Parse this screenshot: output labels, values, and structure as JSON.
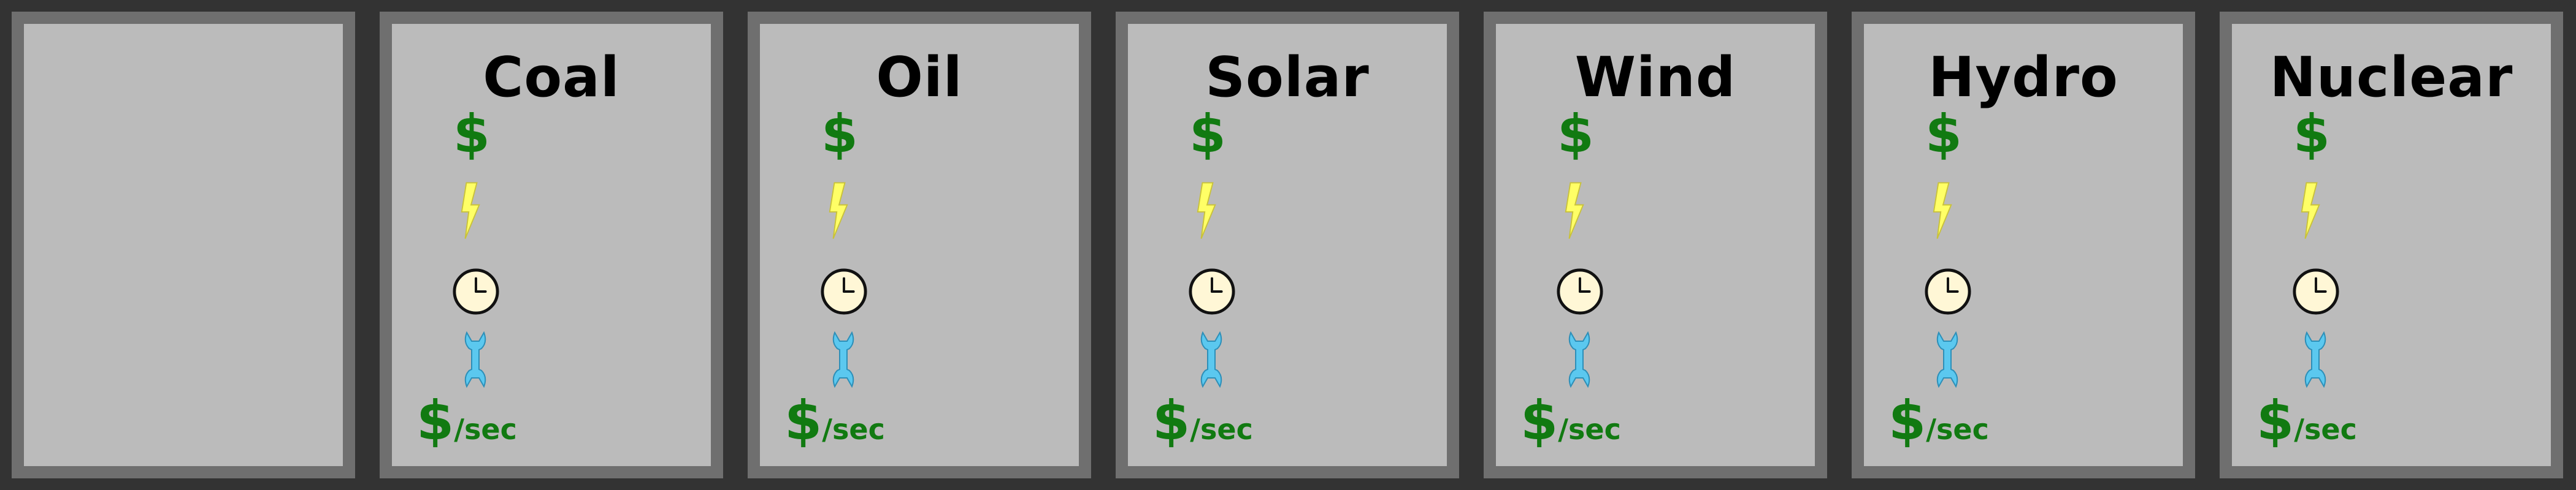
{
  "icons": {
    "money": "dollar-icon",
    "power": "lightning-bolt-icon",
    "time": "clock-icon",
    "maintenance": "wrench-icon"
  },
  "colors": {
    "background": "#333333",
    "card_border": "#6f6f6f",
    "card_fill": "#bbbbbb",
    "money_green": "#117a11",
    "bolt_yellow": "#ffff66",
    "clock_face": "#fff7d6",
    "wrench_blue": "#5bc8ef"
  },
  "symbols": {
    "cost": "$",
    "rate_symbol": "$",
    "rate_unit": "/sec"
  },
  "cards": [
    {
      "title": ""
    },
    {
      "title": "Coal"
    },
    {
      "title": "Oil"
    },
    {
      "title": "Solar"
    },
    {
      "title": "Wind"
    },
    {
      "title": "Hydro"
    },
    {
      "title": "Nuclear"
    }
  ]
}
